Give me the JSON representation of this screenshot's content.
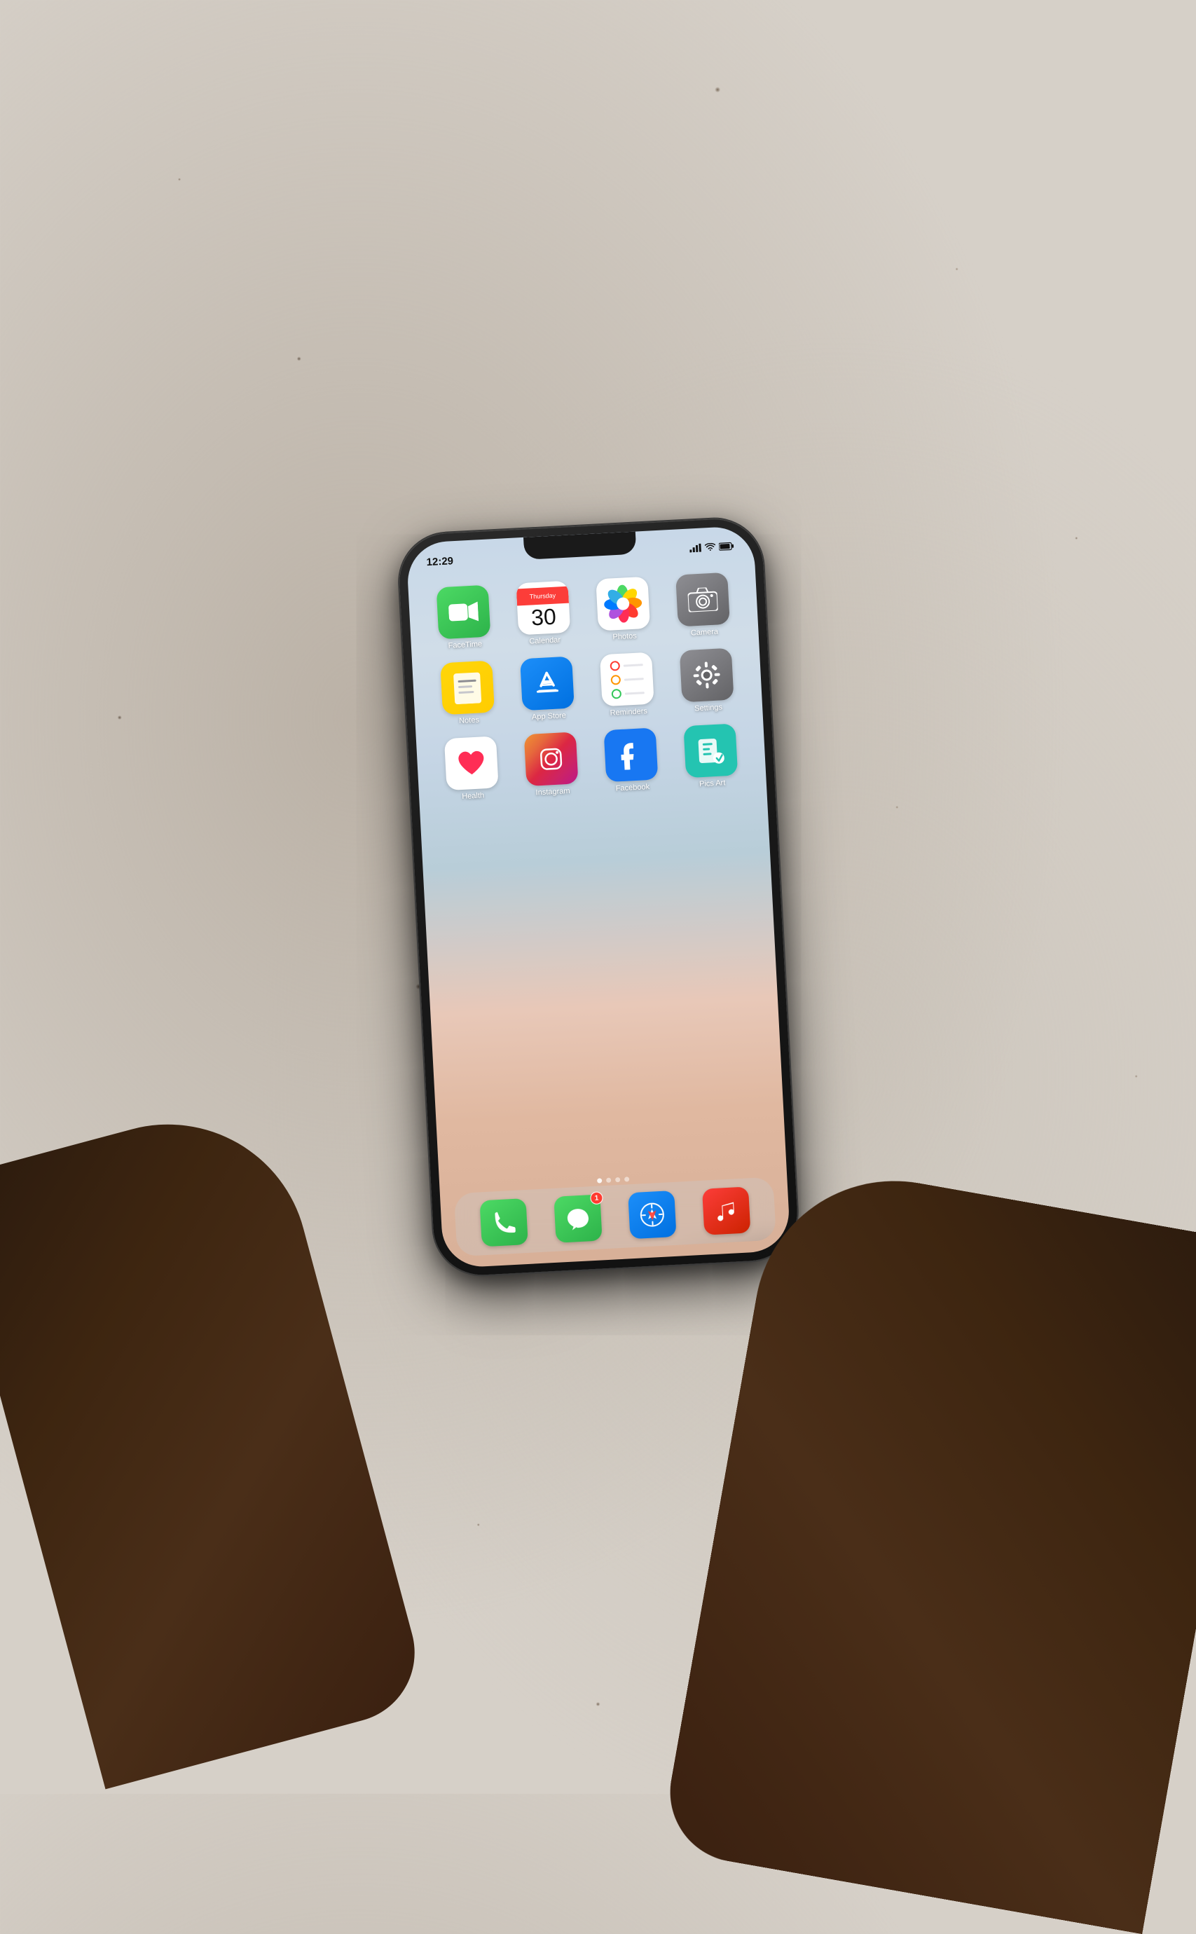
{
  "background": {
    "color": "#d6d0c8"
  },
  "phone": {
    "status_bar": {
      "time": "12:29",
      "signal": "●●●",
      "wifi": "WiFi",
      "battery": "🔋"
    },
    "apps": [
      {
        "id": "facetime",
        "label": "FaceTime",
        "icon_type": "facetime"
      },
      {
        "id": "calendar",
        "label": "Calendar",
        "icon_type": "calendar",
        "day_name": "Thursday",
        "day_number": "30"
      },
      {
        "id": "photos",
        "label": "Photos",
        "icon_type": "photos"
      },
      {
        "id": "camera",
        "label": "Camera",
        "icon_type": "camera"
      },
      {
        "id": "notes",
        "label": "Notes",
        "icon_type": "notes"
      },
      {
        "id": "appstore",
        "label": "App Store",
        "icon_type": "appstore"
      },
      {
        "id": "reminders",
        "label": "Reminders",
        "icon_type": "reminders"
      },
      {
        "id": "settings",
        "label": "Settings",
        "icon_type": "settings"
      },
      {
        "id": "health",
        "label": "Health",
        "icon_type": "health"
      },
      {
        "id": "instagram",
        "label": "Instagram",
        "icon_type": "instagram"
      },
      {
        "id": "facebook",
        "label": "Facebook",
        "icon_type": "facebook"
      },
      {
        "id": "picsart",
        "label": "Pics Art",
        "icon_type": "picsart"
      }
    ],
    "page_dots": [
      true,
      false,
      false,
      false
    ],
    "dock": [
      {
        "id": "phone",
        "label": "Phone",
        "icon_type": "phone"
      },
      {
        "id": "messages",
        "label": "Messages",
        "icon_type": "messages",
        "badge": "1"
      },
      {
        "id": "safari",
        "label": "Safari",
        "icon_type": "safari"
      },
      {
        "id": "music",
        "label": "Music",
        "icon_type": "music"
      }
    ]
  }
}
